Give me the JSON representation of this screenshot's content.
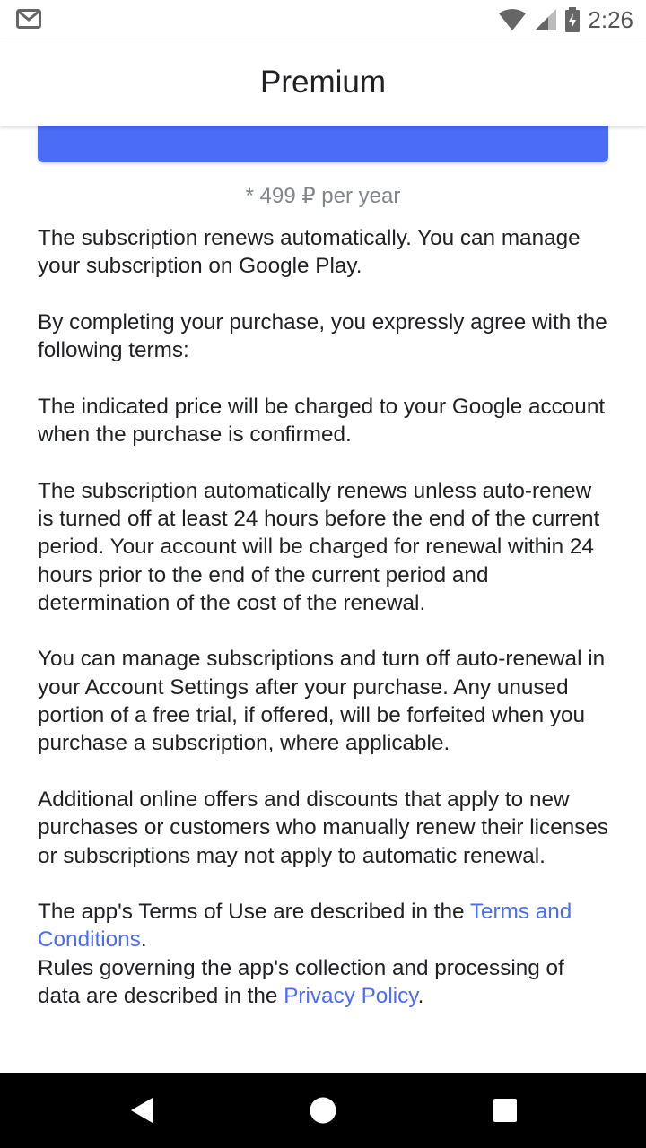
{
  "status_bar": {
    "time": "2:26",
    "icons": [
      "gmail-icon",
      "wifi-icon",
      "cell-signal-icon",
      "battery-charging-icon"
    ]
  },
  "header": {
    "title": "Premium"
  },
  "main": {
    "price_note": "* 499 ₽ per year",
    "paragraphs": {
      "p1": "The subscription renews automatically. You can manage your subscription on Google Play.",
      "p2": "By completing your purchase, you expressly agree with the following terms:",
      "p3": "The indicated price will be charged to your Google account when the purchase is confirmed.",
      "p4": "The subscription automatically renews unless auto-renew is turned off at least 24 hours before the end of the current period. Your account will be charged for renewal within 24 hours prior to the end of the current period and determination of the cost of the renewal.",
      "p5": "You can manage subscriptions and turn off auto-renewal in your Account Settings after your purchase. Any unused portion of a free trial, if offered, will be forfeited when you purchase a subscription, where applicable.",
      "p6": "Additional online offers and discounts that apply to new purchases or customers who manually renew their licenses or subscriptions may not apply to automatic renewal."
    },
    "terms_line": {
      "prefix": "The app's Terms of Use are described in the ",
      "link": "Terms and Conditions",
      "suffix": "."
    },
    "privacy_line": {
      "prefix": "Rules governing the app's collection and processing of data are described in the ",
      "link": "Privacy Policy",
      "suffix": "."
    }
  },
  "nav_bar": {
    "buttons": [
      "back-icon",
      "home-icon",
      "recents-icon"
    ]
  },
  "colors": {
    "accent": "#4a6cf7",
    "text": "#202124",
    "muted": "#80868b",
    "nav_background": "#000000"
  }
}
